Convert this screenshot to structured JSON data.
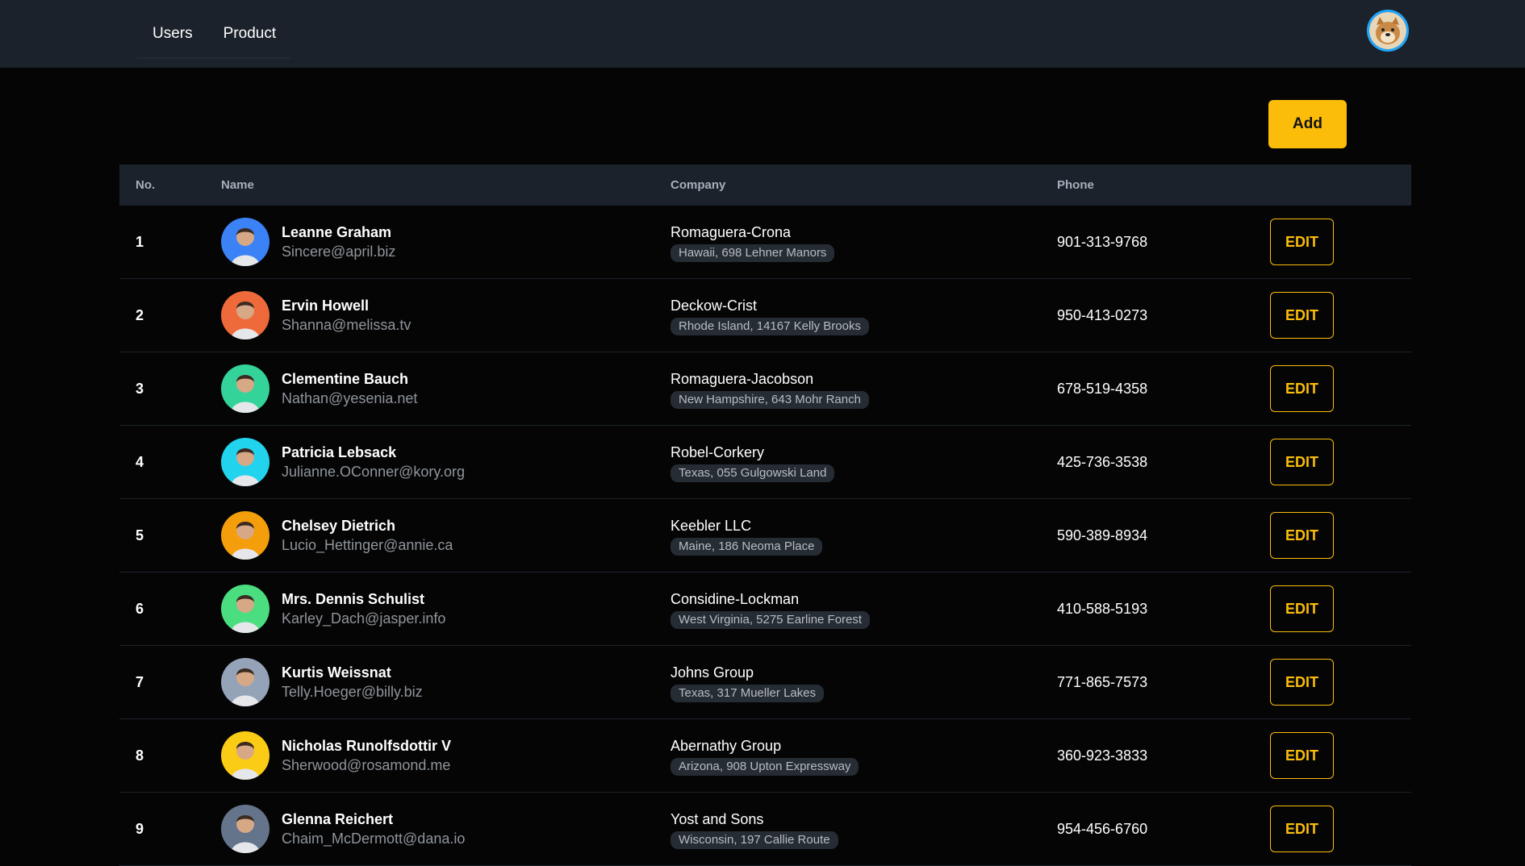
{
  "nav": {
    "items": [
      "Users",
      "Product"
    ]
  },
  "header": {
    "avatar_icon": "dog-avatar-icon"
  },
  "toolbar": {
    "add_label": "Add"
  },
  "table": {
    "columns": [
      "No.",
      "Name",
      "Company",
      "Phone"
    ],
    "edit_label": "EDIT",
    "rows": [
      {
        "no": "1",
        "name": "Leanne Graham",
        "email": "Sincere@april.biz",
        "company": "Romaguera-Crona",
        "address": "Hawaii, 698 Lehner Manors",
        "phone": "901-313-9768",
        "avatar_color": "#3b82f6"
      },
      {
        "no": "2",
        "name": "Ervin Howell",
        "email": "Shanna@melissa.tv",
        "company": "Deckow-Crist",
        "address": "Rhode Island, 14167 Kelly Brooks",
        "phone": "950-413-0273",
        "avatar_color": "#ef6a3a"
      },
      {
        "no": "3",
        "name": "Clementine Bauch",
        "email": "Nathan@yesenia.net",
        "company": "Romaguera-Jacobson",
        "address": "New Hampshire, 643 Mohr Ranch",
        "phone": "678-519-4358",
        "avatar_color": "#34d399"
      },
      {
        "no": "4",
        "name": "Patricia Lebsack",
        "email": "Julianne.OConner@kory.org",
        "company": "Robel-Corkery",
        "address": "Texas, 055 Gulgowski Land",
        "phone": "425-736-3538",
        "avatar_color": "#22d3ee"
      },
      {
        "no": "5",
        "name": "Chelsey Dietrich",
        "email": "Lucio_Hettinger@annie.ca",
        "company": "Keebler LLC",
        "address": "Maine, 186 Neoma Place",
        "phone": "590-389-8934",
        "avatar_color": "#f59e0b"
      },
      {
        "no": "6",
        "name": "Mrs. Dennis Schulist",
        "email": "Karley_Dach@jasper.info",
        "company": "Considine-Lockman",
        "address": "West Virginia, 5275 Earline Forest",
        "phone": "410-588-5193",
        "avatar_color": "#4ade80"
      },
      {
        "no": "7",
        "name": "Kurtis Weissnat",
        "email": "Telly.Hoeger@billy.biz",
        "company": "Johns Group",
        "address": "Texas, 317 Mueller Lakes",
        "phone": "771-865-7573",
        "avatar_color": "#94a3b8"
      },
      {
        "no": "8",
        "name": "Nicholas Runolfsdottir V",
        "email": "Sherwood@rosamond.me",
        "company": "Abernathy Group",
        "address": "Arizona, 908 Upton Expressway",
        "phone": "360-923-3833",
        "avatar_color": "#facc15"
      },
      {
        "no": "9",
        "name": "Glenna Reichert",
        "email": "Chaim_McDermott@dana.io",
        "company": "Yost and Sons",
        "address": "Wisconsin, 197 Callie Route",
        "phone": "954-456-6760",
        "avatar_color": "#64748b"
      }
    ]
  }
}
